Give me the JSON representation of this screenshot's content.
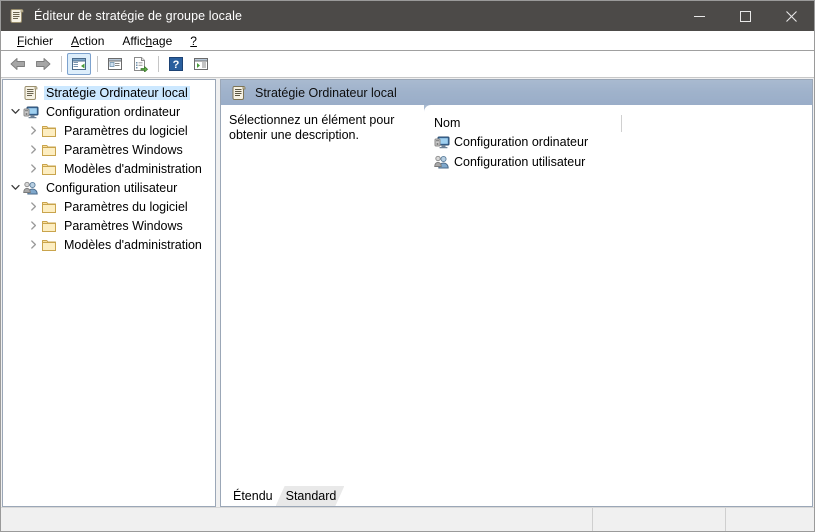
{
  "window": {
    "title": "Éditeur de stratégie de groupe locale",
    "icon": "policy-scroll-icon",
    "controls": {
      "minimize": "minimize-button",
      "maximize": "maximize-button",
      "close": "close-button"
    }
  },
  "menubar": {
    "items": [
      {
        "label": "Fichier",
        "accel": "F"
      },
      {
        "label": "Action",
        "accel": "A"
      },
      {
        "label": "Affichage",
        "accel": "h"
      },
      {
        "label": "?",
        "accel": ""
      }
    ]
  },
  "toolbar": {
    "buttons": [
      {
        "name": "back-icon",
        "tooltip": "Précédent"
      },
      {
        "name": "forward-icon",
        "tooltip": "Suivant"
      },
      {
        "name": "show-hide-tree-icon",
        "tooltip": "Afficher/Masquer l'arborescence",
        "active": true
      },
      {
        "name": "properties-icon",
        "tooltip": "Propriétés"
      },
      {
        "name": "export-list-icon",
        "tooltip": "Exporter la liste"
      },
      {
        "name": "help-icon",
        "tooltip": "Aide"
      },
      {
        "name": "show-detail-pane-icon",
        "tooltip": "Volet de détails"
      }
    ]
  },
  "tree": {
    "items": [
      {
        "label": "Stratégie Ordinateur local",
        "icon": "policy-scroll-icon",
        "level": 0,
        "expander": "none",
        "selected": true
      },
      {
        "label": "Configuration ordinateur",
        "icon": "computer-config-icon",
        "level": 1,
        "expander": "expanded",
        "selected": false
      },
      {
        "label": "Paramètres du logiciel",
        "icon": "folder-icon",
        "level": 2,
        "expander": "collapsed",
        "selected": false
      },
      {
        "label": "Paramètres Windows",
        "icon": "folder-icon",
        "level": 2,
        "expander": "collapsed",
        "selected": false
      },
      {
        "label": "Modèles d'administration",
        "icon": "folder-icon",
        "level": 2,
        "expander": "collapsed",
        "selected": false
      },
      {
        "label": "Configuration utilisateur",
        "icon": "user-config-icon",
        "level": 1,
        "expander": "expanded",
        "selected": false
      },
      {
        "label": "Paramètres du logiciel",
        "icon": "folder-icon",
        "level": 2,
        "expander": "collapsed",
        "selected": false
      },
      {
        "label": "Paramètres Windows",
        "icon": "folder-icon",
        "level": 2,
        "expander": "collapsed",
        "selected": false
      },
      {
        "label": "Modèles d'administration",
        "icon": "folder-icon",
        "level": 2,
        "expander": "collapsed",
        "selected": false
      }
    ]
  },
  "rightpane": {
    "header": {
      "title": "Stratégie Ordinateur local",
      "icon": "policy-scroll-icon"
    },
    "description": "Sélectionnez un élément pour obtenir une description.",
    "column_headers": [
      "Nom"
    ],
    "rows": [
      {
        "name": "Configuration ordinateur",
        "icon": "computer-config-icon"
      },
      {
        "name": "Configuration utilisateur",
        "icon": "user-config-icon"
      }
    ]
  },
  "tabs": [
    {
      "label": "Étendu",
      "selected": false
    },
    {
      "label": "Standard",
      "selected": true
    }
  ],
  "statusbar": {
    "cells": [
      "",
      "",
      ""
    ]
  },
  "colors": {
    "titlebar": "#4c4a48",
    "selection": "#cce8ff",
    "pane_header": "#9fb2cb",
    "folder": "#f8d58a"
  }
}
